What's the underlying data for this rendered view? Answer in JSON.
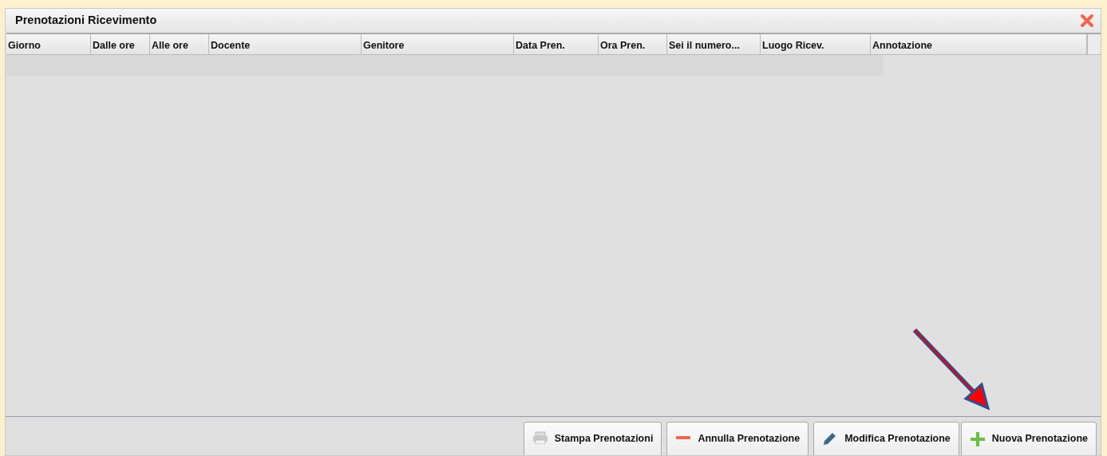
{
  "window": {
    "title": "Prenotazioni Ricevimento"
  },
  "table": {
    "columns": [
      "Giorno",
      "Dalle ore",
      "Alle ore",
      "Docente",
      "Genitore",
      "Data Pren.",
      "Ora Pren.",
      "Sei il numero...",
      "Luogo Ricev.",
      "Annotazione"
    ]
  },
  "buttons": [
    {
      "label": "Stampa Prenotazioni",
      "kind": "print"
    },
    {
      "label": "Annulla Prenotazione",
      "kind": "minus"
    },
    {
      "label": "Modifica Prenotazione",
      "kind": "pencil"
    },
    {
      "label": "Nuova Prenotazione",
      "kind": "plus"
    }
  ]
}
